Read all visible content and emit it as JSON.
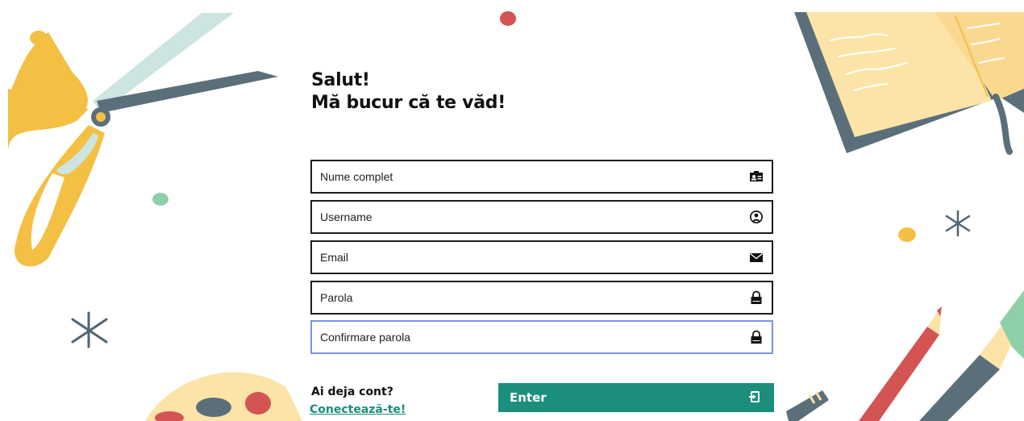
{
  "greeting": {
    "line1": "Salut!",
    "line2": "Mă bucur că te văd!"
  },
  "form": {
    "fields": [
      {
        "placeholder": "Nume complet",
        "value": "",
        "icon": "id-card-icon"
      },
      {
        "placeholder": "Username",
        "value": "",
        "icon": "user-circle-icon"
      },
      {
        "placeholder": "Email",
        "value": "",
        "icon": "envelope-icon"
      },
      {
        "placeholder": "Parola",
        "value": "",
        "icon": "lock-icon"
      },
      {
        "placeholder": "Confirmare parola",
        "value": "",
        "icon": "lock-icon"
      }
    ],
    "submit_label": "Enter",
    "submit_icon": "sign-in-icon"
  },
  "footer": {
    "question": "Ai deja cont?",
    "login_link": "Conectează-te!"
  },
  "colors": {
    "accent": "#1b8f7b",
    "link": "#1a8d7c",
    "focus_border": "#7a93e6",
    "field_border": "#1d1d1d"
  }
}
